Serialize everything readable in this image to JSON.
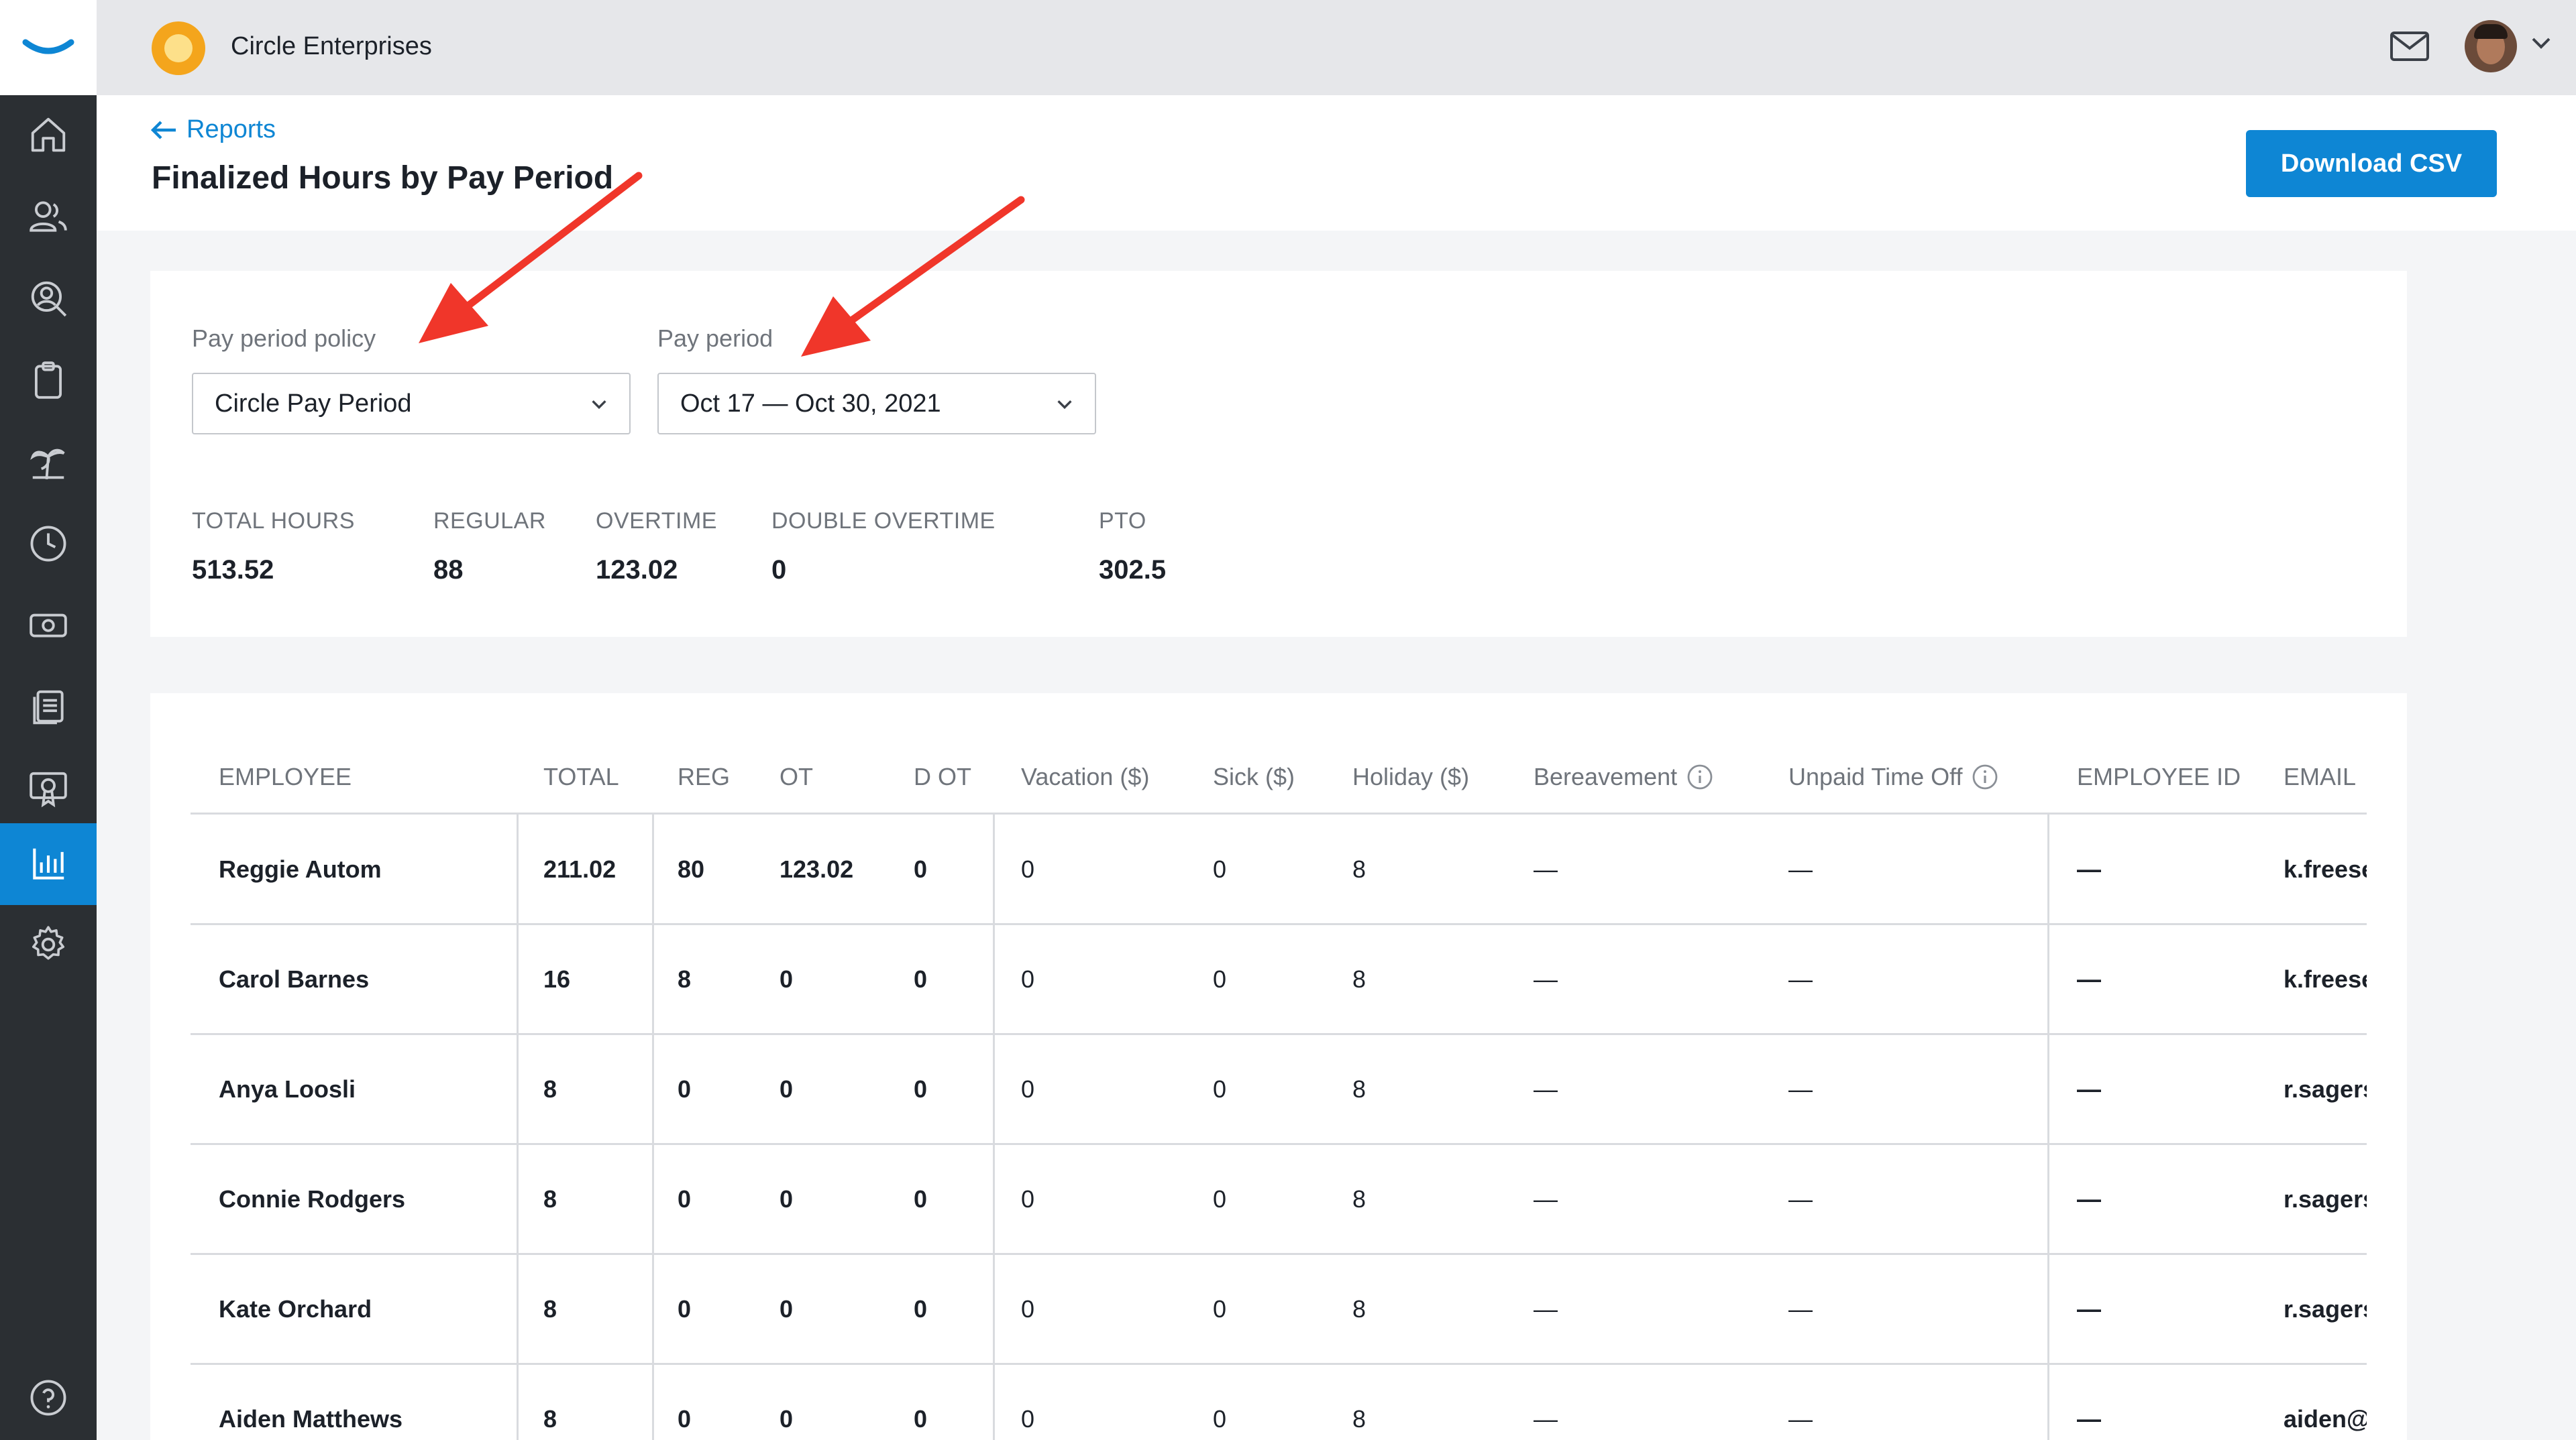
{
  "org": {
    "name": "Circle Enterprises"
  },
  "nav": [
    "home-icon",
    "people-icon",
    "search-person-icon",
    "clipboard-icon",
    "palm-tree-icon",
    "clock-icon",
    "money-icon",
    "documents-icon",
    "certificate-icon",
    "reports-icon",
    "settings-icon",
    "help-icon"
  ],
  "header": {
    "back_label": "Reports",
    "title": "Finalized Hours by Pay Period",
    "download_label": "Download CSV"
  },
  "filters": {
    "policy_label": "Pay period policy",
    "policy_value": "Circle Pay Period",
    "period_label": "Pay period",
    "period_value": "Oct 17 — Oct 30, 2021"
  },
  "summary": [
    {
      "label": "TOTAL HOURS",
      "value": "513.52"
    },
    {
      "label": "REGULAR",
      "value": "88"
    },
    {
      "label": "OVERTIME",
      "value": "123.02"
    },
    {
      "label": "DOUBLE OVERTIME",
      "value": "0"
    },
    {
      "label": "PTO",
      "value": "302.5"
    }
  ],
  "table": {
    "columns": [
      "EMPLOYEE",
      "TOTAL",
      "REG",
      "OT",
      "D OT",
      "Vacation ($)",
      "Sick ($)",
      "Holiday ($)",
      "Bereavement",
      "Unpaid Time Off",
      "EMPLOYEE ID",
      "EMAIL"
    ],
    "rows": [
      [
        "Reggie Autom",
        "211.02",
        "80",
        "123.02",
        "0",
        "0",
        "0",
        "8",
        "—",
        "—",
        "—",
        "k.freese@"
      ],
      [
        "Carol Barnes",
        "16",
        "8",
        "0",
        "0",
        "0",
        "0",
        "8",
        "—",
        "—",
        "—",
        "k.freese@"
      ],
      [
        "Anya Loosli",
        "8",
        "0",
        "0",
        "0",
        "0",
        "0",
        "8",
        "—",
        "—",
        "—",
        "r.sagers@"
      ],
      [
        "Connie Rodgers",
        "8",
        "0",
        "0",
        "0",
        "0",
        "0",
        "8",
        "—",
        "—",
        "—",
        "r.sagers@"
      ],
      [
        "Kate Orchard",
        "8",
        "0",
        "0",
        "0",
        "0",
        "0",
        "8",
        "—",
        "—",
        "—",
        "r.sagers@"
      ],
      [
        "Aiden Matthews",
        "8",
        "0",
        "0",
        "0",
        "0",
        "0",
        "8",
        "—",
        "—",
        "—",
        "aiden@"
      ]
    ]
  },
  "colors": {
    "accent": "#0e86d4",
    "sidebar": "#2b2f33",
    "annotation": "#f0362a"
  }
}
